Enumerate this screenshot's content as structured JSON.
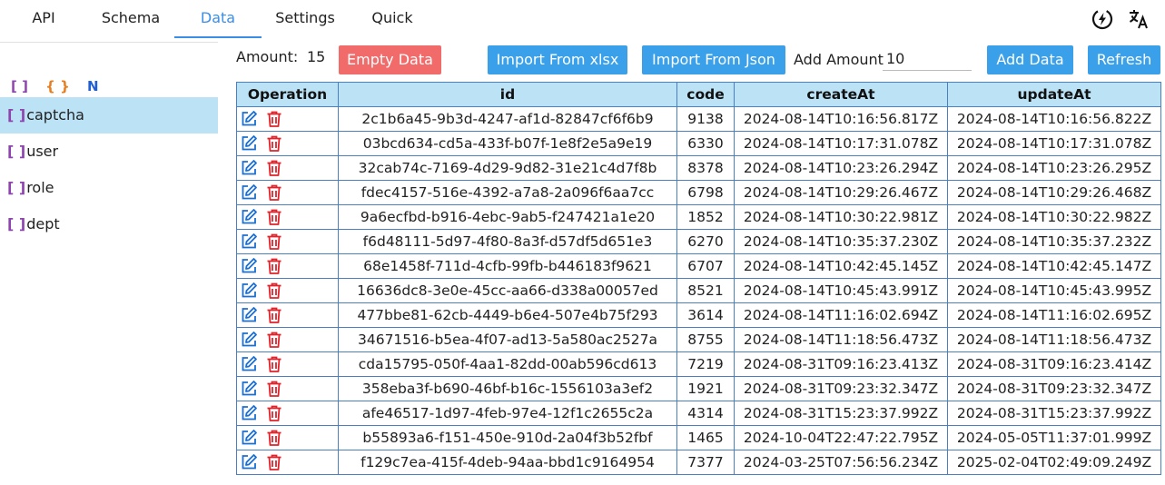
{
  "nav": {
    "tabs": [
      {
        "label": "API"
      },
      {
        "label": "Schema"
      },
      {
        "label": "Data"
      },
      {
        "label": "Settings"
      },
      {
        "label": "Quick"
      }
    ],
    "active_tab": "Data",
    "icons": [
      "bolt-icon",
      "translate-icon"
    ]
  },
  "sidebar": {
    "filters": [
      "[ ]",
      "{ }",
      "N"
    ],
    "items": [
      {
        "bracket": "[ ]",
        "label": "captcha"
      },
      {
        "bracket": "[ ]",
        "label": "user"
      },
      {
        "bracket": "[ ]",
        "label": "role"
      },
      {
        "bracket": "[ ]",
        "label": "dept"
      }
    ],
    "active_item": "captcha"
  },
  "toolbar": {
    "amount_label": "Amount:",
    "amount_value": "15",
    "empty_label": "Empty Data",
    "import_xlsx_label": "Import From xlsx",
    "import_json_label": "Import From Json",
    "add_amount_label": "Add Amount",
    "add_amount_value": "10",
    "add_data_label": "Add Data",
    "refresh_label": "Refresh"
  },
  "colors": {
    "accent": "#3aa0ea",
    "danger": "#f26b6b",
    "header_bg": "#bce2f6",
    "border": "#4a7fc1"
  },
  "table": {
    "headers": [
      "Operation",
      "id",
      "code",
      "createAt",
      "updateAt"
    ],
    "rows": [
      {
        "id": "2c1b6a45-9b3d-4247-af1d-82847cf6f6b9",
        "code": "9138",
        "createAt": "2024-08-14T10:16:56.817Z",
        "updateAt": "2024-08-14T10:16:56.822Z"
      },
      {
        "id": "03bcd634-cd5a-433f-b07f-1e8f2e5a9e19",
        "code": "6330",
        "createAt": "2024-08-14T10:17:31.078Z",
        "updateAt": "2024-08-14T10:17:31.078Z"
      },
      {
        "id": "32cab74c-7169-4d29-9d82-31e21c4d7f8b",
        "code": "8378",
        "createAt": "2024-08-14T10:23:26.294Z",
        "updateAt": "2024-08-14T10:23:26.295Z"
      },
      {
        "id": "fdec4157-516e-4392-a7a8-2a096f6aa7cc",
        "code": "6798",
        "createAt": "2024-08-14T10:29:26.467Z",
        "updateAt": "2024-08-14T10:29:26.468Z"
      },
      {
        "id": "9a6ecfbd-b916-4ebc-9ab5-f247421a1e20",
        "code": "1852",
        "createAt": "2024-08-14T10:30:22.981Z",
        "updateAt": "2024-08-14T10:30:22.982Z"
      },
      {
        "id": "f6d48111-5d97-4f80-8a3f-d57df5d651e3",
        "code": "6270",
        "createAt": "2024-08-14T10:35:37.230Z",
        "updateAt": "2024-08-14T10:35:37.232Z"
      },
      {
        "id": "68e1458f-711d-4cfb-99fb-b446183f9621",
        "code": "6707",
        "createAt": "2024-08-14T10:42:45.145Z",
        "updateAt": "2024-08-14T10:42:45.147Z"
      },
      {
        "id": "16636dc8-3e0e-45cc-aa66-d338a00057ed",
        "code": "8521",
        "createAt": "2024-08-14T10:45:43.991Z",
        "updateAt": "2024-08-14T10:45:43.995Z"
      },
      {
        "id": "477bbe81-62cb-4449-b6e4-507e4b75f293",
        "code": "3614",
        "createAt": "2024-08-14T11:16:02.694Z",
        "updateAt": "2024-08-14T11:16:02.695Z"
      },
      {
        "id": "34671516-b5ea-4f07-ad13-5a580ac2527a",
        "code": "8755",
        "createAt": "2024-08-14T11:18:56.473Z",
        "updateAt": "2024-08-14T11:18:56.473Z"
      },
      {
        "id": "cda15795-050f-4aa1-82dd-00ab596cd613",
        "code": "7219",
        "createAt": "2024-08-31T09:16:23.413Z",
        "updateAt": "2024-08-31T09:16:23.414Z"
      },
      {
        "id": "358eba3f-b690-46bf-b16c-1556103a3ef2",
        "code": "1921",
        "createAt": "2024-08-31T09:23:32.347Z",
        "updateAt": "2024-08-31T09:23:32.347Z"
      },
      {
        "id": "afe46517-1d97-4feb-97e4-12f1c2655c2a",
        "code": "4314",
        "createAt": "2024-08-31T15:23:37.992Z",
        "updateAt": "2024-08-31T15:23:37.992Z"
      },
      {
        "id": "b55893a6-f151-450e-910d-2a04f3b52fbf",
        "code": "1465",
        "createAt": "2024-10-04T22:47:22.795Z",
        "updateAt": "2024-05-05T11:37:01.999Z"
      },
      {
        "id": "f129c7ea-415f-4deb-94aa-bbd1c9164954",
        "code": "7377",
        "createAt": "2024-03-25T07:56:56.234Z",
        "updateAt": "2025-02-04T02:49:09.249Z"
      }
    ]
  }
}
